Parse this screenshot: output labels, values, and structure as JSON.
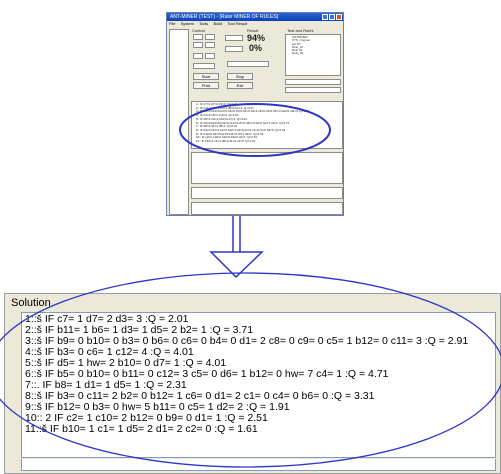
{
  "thumbnail": {
    "window_title": "ANT-MINER (TEST) - [Ruler MINER OF RULES]",
    "menu": [
      "File",
      "System",
      "Tools",
      "Build",
      "Tool Result"
    ],
    "control_label": "Control",
    "result_label": "Result",
    "pct_1": "94%",
    "pct_2": "0%",
    "buttons": [
      "Start",
      "Stop",
      "Print",
      "Exit"
    ],
    "list_title": "Test and Rules",
    "tree_items": [
      "ANTMINER",
      "PTS_Original",
      "ant RT",
      "Rule_01",
      "Rule 02",
      "Rule_03"
    ],
    "solution_preview": [
      "1:: IF c7=1 d7=2 d3=3 :Q=2.01",
      "2:: IF b11=1 b6=1 d3=1 d5=2 b2=1 :Q=3.71",
      "3:: IF b9=0 b10=0 b3=0 b6=0 c6=0 b4=0 d1=2 c8=0 c9=0 c5=1 b12=0 c11=3 :Q=2.91",
      "4:: IF b3=0 c6=1 c12=4 :Q=4.01",
      "5:: IF d5=1 hw=2 b10=0 d7=1 :Q=4.01",
      "6:: IF b5=0 b10=0 b11=0 c12=3 c5=0 d6=1 b12=0 hw=7 c4=1 :Q=4.71",
      "7:: IF b8=1 d1=1 d5=1 :Q=2.31",
      "8:: IF b3=0 c11=2 b2=0 b12=1 c6=0 d1=2 c1=0 c4=0 b6=0 :Q=3.31",
      "9:: IF b12=0 b3=0 hw=5 b11=0 c5=1 d2=2 :Q=1.91",
      "10:: IF c2=1 c10=2 b12=0 b9=0 d1=1 :Q=2.51",
      "11:: IF b10=1 c1=1 d5=2 d1=2 c2=0 :Q=1.61"
    ]
  },
  "solution": {
    "title": "Solution",
    "lines": [
      "1::š IF c7= 1 d7= 2 d3= 3 :Q = 2.01",
      "2::š IF b11= 1 b6= 1 d3= 1 d5= 2 b2= 1 :Q = 3.71",
      "3::š IF b9= 0 b10= 0 b3= 0 b6= 0 c6= 0 b4= 0 d1= 2 c8= 0 c9= 0 c5= 1 b12= 0 c11= 3 :Q = 2.91",
      "4::š IF b3= 0 c6= 1 c12= 4 :Q = 4.01",
      "5::š IF d5= 1 hw= 2 b10= 0 d7= 1 :Q = 4.01",
      "6::š IF b5= 0 b10= 0 b11= 0 c12= 3 c5= 0 d6= 1 b12= 0 hw= 7 c4= 1 :Q = 4.71",
      "7::. IF b8= 1 d1= 1 d5= 1 :Q = 2.31",
      "8::š IF b3= 0 c11= 2 b2= 0 b12= 1 c6= 0 d1= 2 c1= 0 c4= 0 b6= 0 :Q = 3.31",
      "9::š IF b12= 0 b3= 0 hw= 5 b11= 0 c5= 1 d2= 2 :Q = 1.91",
      "10:: 2 IF c2= 1 c10= 2 b12= 0 b9= 0 d1= 1 :Q = 2.51",
      "11::š IF b10= 1 c1= 1 d5= 2 d1= 2 c2= 0 :Q = 1.61"
    ]
  },
  "colors": {
    "ellipse": "#2a36c8",
    "arrow": "#2a36c8",
    "panel": "#ece9d8"
  }
}
